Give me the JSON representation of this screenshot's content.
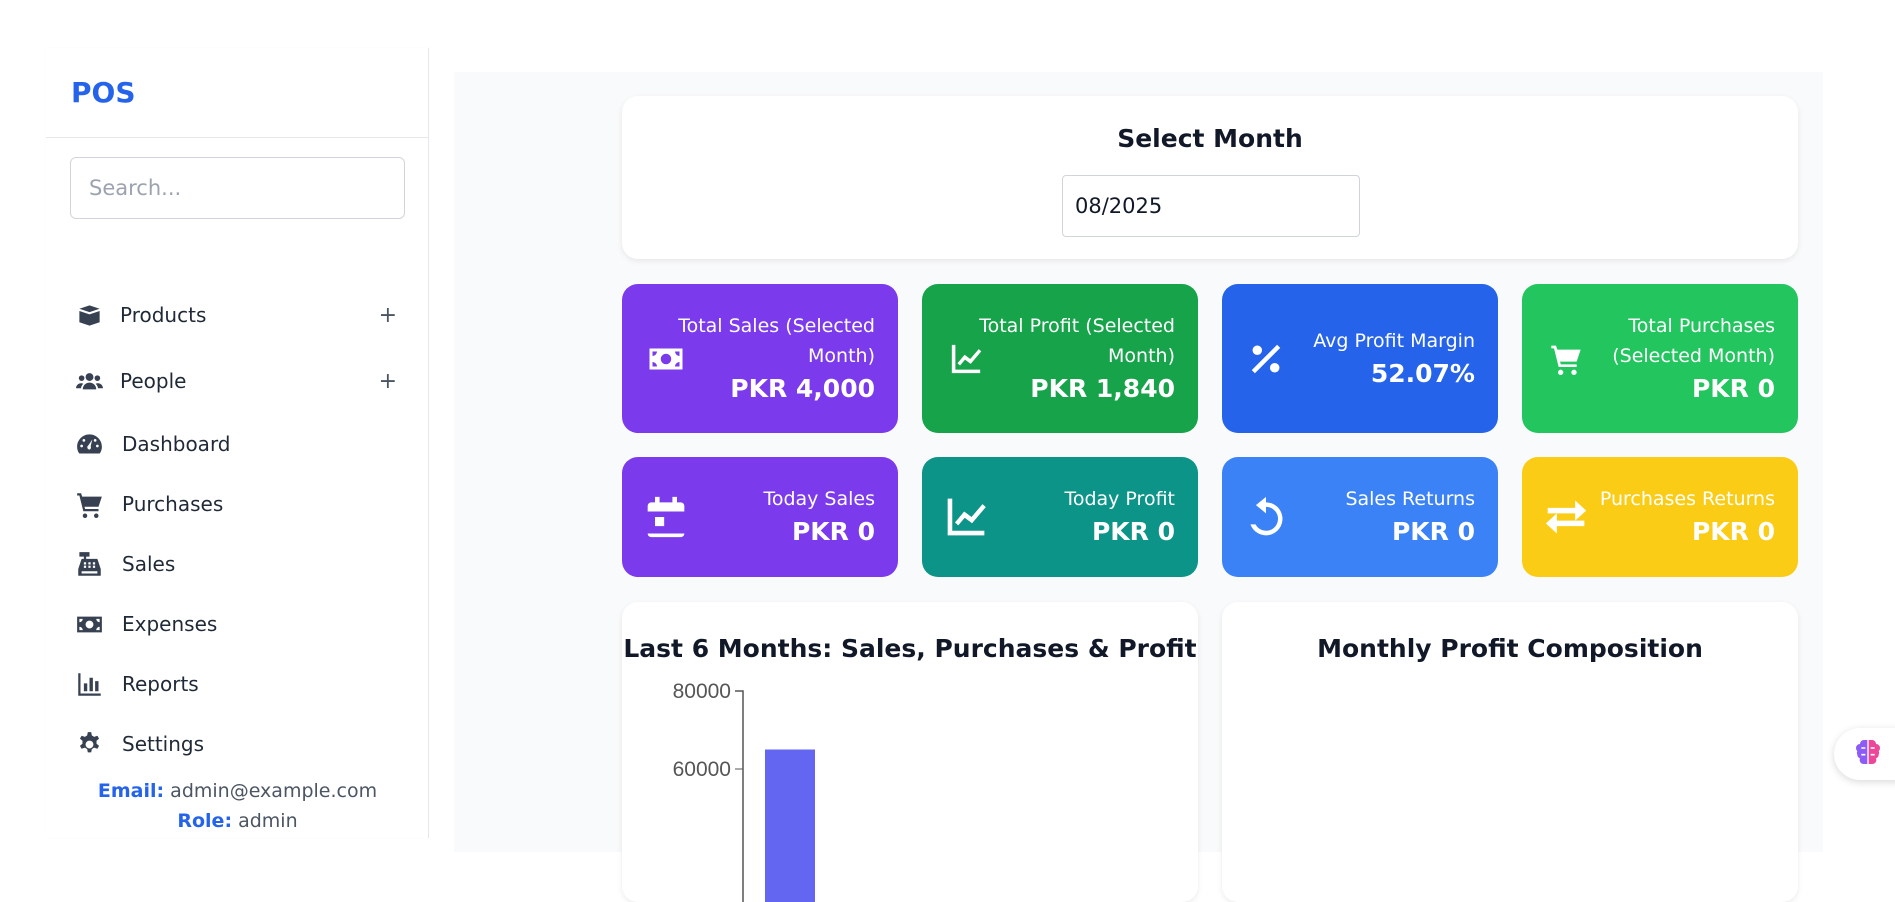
{
  "sidebar": {
    "brand": "POS",
    "search_placeholder": "Search...",
    "items": [
      {
        "label": "Products",
        "icon": "box-open-icon",
        "expand": "+"
      },
      {
        "label": "People",
        "icon": "users-icon",
        "expand": "+"
      },
      {
        "label": "Dashboard",
        "icon": "gauge-icon"
      },
      {
        "label": "Purchases",
        "icon": "cart-icon"
      },
      {
        "label": "Sales",
        "icon": "cash-register-icon"
      },
      {
        "label": "Expenses",
        "icon": "money-bill-icon"
      },
      {
        "label": "Reports",
        "icon": "bar-chart-icon"
      },
      {
        "label": "Settings",
        "icon": "gear-icon"
      }
    ],
    "user": {
      "email_label": "Email:",
      "email": "admin@example.com",
      "role_label": "Role:",
      "role": "admin"
    }
  },
  "month": {
    "title": "Select Month",
    "value": "08/2025"
  },
  "stats": [
    {
      "label": "Total Sales (Selected Month)",
      "value": "PKR 4,000",
      "icon": "money-bill-icon",
      "color": "#7c3aed"
    },
    {
      "label": "Total Profit (Selected Month)",
      "value": "PKR 1,840",
      "icon": "chart-line-icon",
      "color": "#16a34a"
    },
    {
      "label": "Avg Profit Margin",
      "value": "52.07%",
      "icon": "percent-icon",
      "color": "#2563eb"
    },
    {
      "label": "Total Purchases (Selected Month)",
      "value": "PKR 0",
      "icon": "cart-icon",
      "color": "#22c55e"
    },
    {
      "label": "Today Sales",
      "value": "PKR 0",
      "icon": "calendar-icon",
      "color": "#7c3aed"
    },
    {
      "label": "Today Profit",
      "value": "PKR 0",
      "icon": "chart-line-icon",
      "color": "#0d9488"
    },
    {
      "label": "Sales Returns",
      "value": "PKR 0",
      "icon": "undo-icon",
      "color": "#3b82f6"
    },
    {
      "label": "Purchases Returns",
      "value": "PKR 0",
      "icon": "exchange-icon",
      "color": "#facc15"
    }
  ],
  "charts": {
    "left_title": "Last 6 Months: Sales, Purchases & Profit",
    "right_title": "Monthly Profit Composition"
  },
  "chart_data": {
    "type": "bar",
    "title": "Last 6 Months: Sales, Purchases & Profit",
    "y_ticks": [
      "80000",
      "60000"
    ],
    "ylim": [
      0,
      80000
    ],
    "series": [
      {
        "values": [
          65000
        ],
        "color": "#6366f1"
      }
    ]
  }
}
